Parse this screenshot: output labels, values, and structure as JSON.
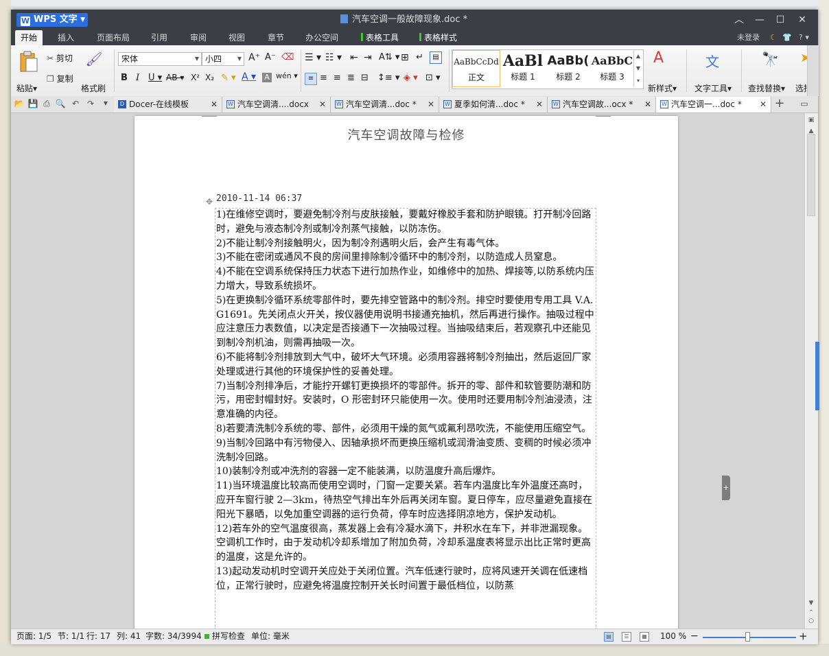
{
  "app": {
    "name": "WPS 文字",
    "doc_title": "汽车空调一般故障现象.doc *"
  },
  "menus": [
    {
      "label": "开始",
      "active": true
    },
    {
      "label": "插入"
    },
    {
      "label": "页面布局"
    },
    {
      "label": "引用"
    },
    {
      "label": "审阅"
    },
    {
      "label": "视图"
    },
    {
      "label": "章节"
    },
    {
      "label": "办公空间"
    },
    {
      "label": "表格工具",
      "contextual": true
    },
    {
      "label": "表格样式",
      "contextual": true
    }
  ],
  "account": {
    "login": "未登录",
    "help": "?"
  },
  "ribbon": {
    "paste": "粘贴",
    "cut": "剪切",
    "copy": "复制",
    "format_painter": "格式刷",
    "font_name": "宋体",
    "font_size": "小四",
    "styles": [
      {
        "preview": "AaBbCcDd",
        "name": "正文"
      },
      {
        "preview": "AaBl",
        "name": "标题 1"
      },
      {
        "preview": "AaBb(",
        "name": "标题 2"
      },
      {
        "preview": "AaBbC",
        "name": "标题 3"
      }
    ],
    "new_style": "新样式",
    "text_tools": "文字工具",
    "find_replace": "查找替换",
    "select": "选择"
  },
  "tabs": [
    {
      "label": "Docer-在线模板"
    },
    {
      "label": "汽车空调清....docx"
    },
    {
      "label": "汽车空调清...doc *"
    },
    {
      "label": "夏季如何清...doc *"
    },
    {
      "label": "汽车空调故...ocx *"
    },
    {
      "label": "汽车空调一...doc *",
      "active": true
    }
  ],
  "document": {
    "heading": "汽车空调故障与检修",
    "date": "2010-11-14 06:37",
    "paragraphs": [
      "1)在维修空调时，要避免制冷剂与皮肤接触，要戴好橡胶手套和防护眼镜。打开制冷回路时，避免与液态制冷剂或制冷剂蒸气接触，以防冻伤。",
      "2)不能让制冷剂接触明火，因为制冷剂遇明火后，会产生有毒气体。",
      "3)不能在密闭或通风不良的房间里排除制冷循环中的制冷剂，以防造成人员窒息。",
      "4)不能在空调系统保持压力状态下进行加热作业，如维修中的加热、焊接等,以防系统内压力增大，导致系统损坏。",
      "5)在更换制冷循环系统零部件时，要先排空管路中的制冷剂。排空时要使用专用工具 V.A.G1691。先关闭点火开关，按仪器使用说明书接通充抽机，然后再进行操作。抽吸过程中应注意压力表数值，以决定是否接通下一次抽吸过程。当抽吸结束后，若观察孔中还能见到制冷剂机油，则需再抽吸一次。",
      "6)不能将制冷剂排放到大气中，破坏大气环境。必须用容器将制冷剂抽出，然后返回厂家处理或进行其他的环境保护性的妥善处理。",
      "7)当制冷剂排净后，才能拧开螺钉更换损坏的零部件。拆开的零、部件和软管要防潮和防污，用密封帽封好。安装时，O 形密封环只能使用一次。使用时还要用制冷剂油浸渍，注意准确的内径。",
      "8)若要清洗制冷系统的零、部件，必须用干燥的氮气或氟利昂吹洗，不能使用压缩空气。",
      "9)当制冷回路中有污物侵入、因轴承损坏而更换压缩机或润滑油变质、变稠的时候必须冲洗制冷回路。",
      "10)装制冷剂或冲洗剂的容器一定不能装满，以防温度升高后爆炸。",
      "11)当环境温度比较高而使用空调时，门窗一定要关紧。若车内温度比车外温度还高时，应开车窗行驶 2—3km，待热空气排出车外后再关闭车窗。夏日停车，应尽量避免直接在阳光下暴晒，以免加重空调器的运行负荷，停车时应选择阴凉地方，保护发动机。",
      "12)若车外的空气温度很高，蒸发器上会有冷凝水滴下，并积水在车下，并非泄漏现象。空调机工作时，由于发动机冷却系增加了附加负荷，冷却系温度表将显示出比正常时更高的温度，这是允许的。",
      "13)起动发动机时空调开关应处于关闭位置。汽车低速行驶时，应将风速开关调在低速档位，正常行驶时，应避免将温度控制开关长时间置于最低档位，以防蒸"
    ]
  },
  "status": {
    "page": "页面: 1/5",
    "section": "节: 1/1",
    "row": "行: 17",
    "col": "列: 41",
    "words": "字数: 34/3994",
    "spell": "拼写检查",
    "unit": "单位: 毫米",
    "zoom": "100 %",
    "zoom_level_percent": 100
  }
}
